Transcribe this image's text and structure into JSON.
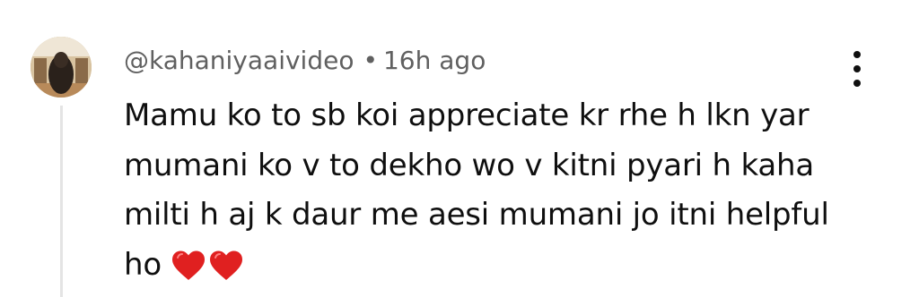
{
  "comment": {
    "author": "@kahaniyaaivideo",
    "separator": "•",
    "time_ago": "16h ago",
    "lines": [
      "Mamu ko to sb koi appreciate kr rhe h lkn yar",
      "mumani ko v to dekho wo v kitni pyari h kaha",
      "milti h aj k daur me aesi mumani jo itni helpful",
      "ho"
    ],
    "reaction_icons": [
      "red-heart-icon",
      "red-heart-icon"
    ],
    "more_icon": "vertical-ellipsis-icon"
  },
  "colors": {
    "meta_text": "#606060",
    "body_text": "#0f0f0f",
    "heart": "#e02020",
    "thread_line": "#e4e4e4"
  }
}
